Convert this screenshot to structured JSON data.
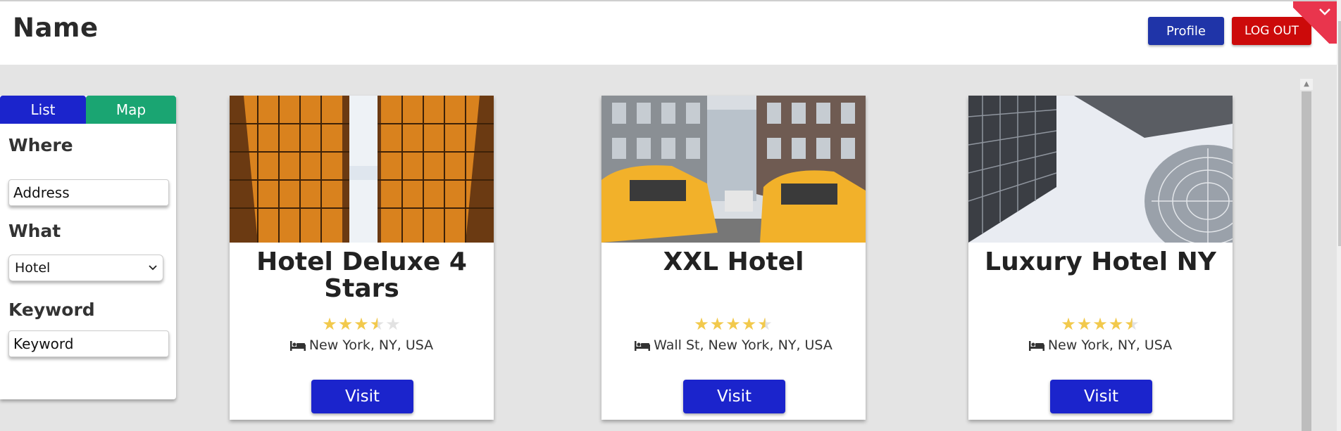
{
  "header": {
    "title": "Name",
    "profile_label": "Profile",
    "logout_label": "LOG OUT",
    "menu_icon": "chevron-down-icon"
  },
  "sidebar": {
    "tabs": [
      {
        "label": "List",
        "color": "#1b24cc",
        "active": true
      },
      {
        "label": "Map",
        "color": "#1aa572",
        "active": false
      }
    ],
    "where_label": "Where",
    "address_placeholder": "Address",
    "what_label": "What",
    "what_selected": "Hotel",
    "keyword_label": "Keyword",
    "keyword_placeholder": "Keyword"
  },
  "hotels": [
    {
      "title": "Hotel Deluxe 4 Stars",
      "rating": 3.5,
      "location": "New York, NY, USA",
      "visit_label": "Visit",
      "image": "orange-glass-skyscrapers-photo"
    },
    {
      "title": "XXL Hotel",
      "rating": 4.5,
      "location": "Wall St, New York, NY, USA",
      "visit_label": "Visit",
      "image": "new-york-taxi-street-photo"
    },
    {
      "title": "Luxury Hotel NY",
      "rating": 4.5,
      "location": "New York, NY, USA",
      "visit_label": "Visit",
      "image": "modern-towers-sky-photo"
    }
  ],
  "colors": {
    "primary": "#1b24cc",
    "profile": "#1f34a8",
    "logout": "#cc0a0a",
    "map_tab": "#1aa572",
    "star": "#f2c94c",
    "ribbon": "#e9354d"
  }
}
